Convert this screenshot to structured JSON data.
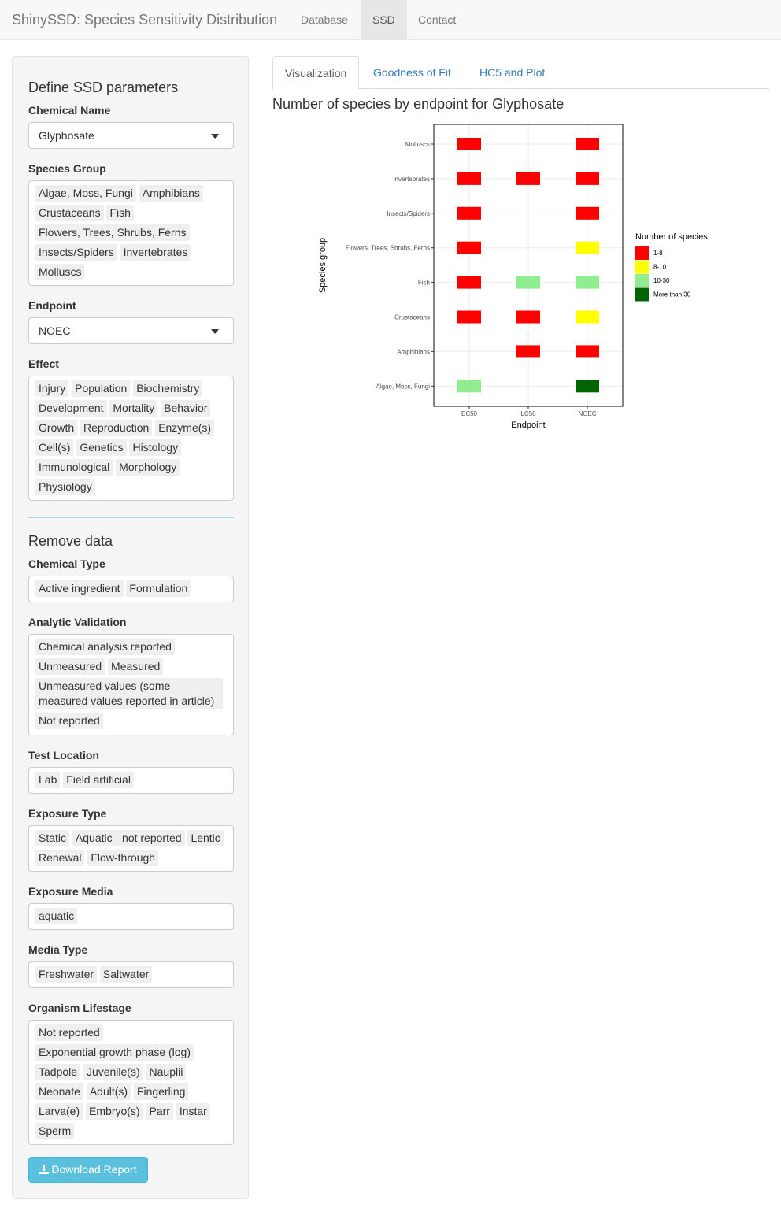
{
  "navbar": {
    "brand": "ShinySSD: Species Sensitivity Distribution",
    "items": [
      "Database",
      "SSD",
      "Contact"
    ],
    "active": "SSD"
  },
  "sidebar": {
    "define_title": "Define SSD parameters",
    "chemical_name": {
      "label": "Chemical Name",
      "value": "Glyphosate"
    },
    "species_group": {
      "label": "Species Group",
      "selected": [
        "Algae, Moss, Fungi",
        "Amphibians",
        "Crustaceans",
        "Fish",
        "Flowers, Trees, Shrubs, Ferns",
        "Insects/Spiders",
        "Invertebrates",
        "Molluscs"
      ]
    },
    "endpoint": {
      "label": "Endpoint",
      "value": "NOEC"
    },
    "effect": {
      "label": "Effect",
      "selected": [
        "Injury",
        "Population",
        "Biochemistry",
        "Development",
        "Mortality",
        "Behavior",
        "Growth",
        "Reproduction",
        "Enzyme(s)",
        "Cell(s)",
        "Genetics",
        "Histology",
        "Immunological",
        "Morphology",
        "Physiology"
      ]
    },
    "remove_title": "Remove data",
    "chemical_type": {
      "label": "Chemical Type",
      "selected": [
        "Active ingredient",
        "Formulation"
      ]
    },
    "analytic_validation": {
      "label": "Analytic Validation",
      "selected": [
        "Chemical analysis reported",
        "Unmeasured",
        "Measured",
        "Unmeasured values (some measured values reported in article)",
        "Not reported"
      ]
    },
    "test_location": {
      "label": "Test Location",
      "selected": [
        "Lab",
        "Field artificial"
      ]
    },
    "exposure_type": {
      "label": "Exposure Type",
      "selected": [
        "Static",
        "Aquatic - not reported",
        "Lentic",
        "Renewal",
        "Flow-through"
      ]
    },
    "exposure_media": {
      "label": "Exposure Media",
      "selected": [
        "aquatic"
      ]
    },
    "media_type": {
      "label": "Media Type",
      "selected": [
        "Freshwater",
        "Saltwater"
      ]
    },
    "organism_lifestage": {
      "label": "Organism Lifestage",
      "selected": [
        "Not reported",
        "Exponential growth phase (log)",
        "Tadpole",
        "Juvenile(s)",
        "Nauplii",
        "Neonate",
        "Adult(s)",
        "Fingerling",
        "Larva(e)",
        "Embryo(s)",
        "Parr",
        "Instar",
        "Sperm"
      ]
    },
    "download_label": "Download Report"
  },
  "main": {
    "tabs": [
      "Visualization",
      "Goodness of Fit",
      "HC5 and Plot"
    ],
    "active_tab": "Visualization",
    "plot_title": "Number of species by endpoint for Glyphosate"
  },
  "chart_data": {
    "type": "heatmap",
    "xlabel": "Endpoint",
    "ylabel": "Species group",
    "x": [
      "EC50",
      "LC50",
      "NOEC"
    ],
    "y": [
      "Algae, Moss, Fungi",
      "Amphibians",
      "Crustaceans",
      "Fish",
      "Flowers, Trees, Shrubs, Ferns",
      "Insects/Spiders",
      "Invertebrates",
      "Molluscs"
    ],
    "legend_title": "Number of species",
    "legend_placement": "right",
    "categories": [
      {
        "name": "1-8",
        "color": "#ff0000"
      },
      {
        "name": "8-10",
        "color": "#ffff00"
      },
      {
        "name": "10-30",
        "color": "#90ee90"
      },
      {
        "name": "More than 30",
        "color": "#006400"
      }
    ],
    "cells": [
      {
        "x": "EC50",
        "y": "Molluscs",
        "category": "1-8"
      },
      {
        "x": "NOEC",
        "y": "Molluscs",
        "category": "1-8"
      },
      {
        "x": "EC50",
        "y": "Invertebrates",
        "category": "1-8"
      },
      {
        "x": "LC50",
        "y": "Invertebrates",
        "category": "1-8"
      },
      {
        "x": "NOEC",
        "y": "Invertebrates",
        "category": "1-8"
      },
      {
        "x": "EC50",
        "y": "Insects/Spiders",
        "category": "1-8"
      },
      {
        "x": "NOEC",
        "y": "Insects/Spiders",
        "category": "1-8"
      },
      {
        "x": "EC50",
        "y": "Flowers, Trees, Shrubs, Ferns",
        "category": "1-8"
      },
      {
        "x": "NOEC",
        "y": "Flowers, Trees, Shrubs, Ferns",
        "category": "8-10"
      },
      {
        "x": "EC50",
        "y": "Fish",
        "category": "1-8"
      },
      {
        "x": "LC50",
        "y": "Fish",
        "category": "10-30"
      },
      {
        "x": "NOEC",
        "y": "Fish",
        "category": "10-30"
      },
      {
        "x": "EC50",
        "y": "Crustaceans",
        "category": "1-8"
      },
      {
        "x": "LC50",
        "y": "Crustaceans",
        "category": "1-8"
      },
      {
        "x": "NOEC",
        "y": "Crustaceans",
        "category": "8-10"
      },
      {
        "x": "LC50",
        "y": "Amphibians",
        "category": "1-8"
      },
      {
        "x": "NOEC",
        "y": "Amphibians",
        "category": "1-8"
      },
      {
        "x": "EC50",
        "y": "Algae, Moss, Fungi",
        "category": "10-30"
      },
      {
        "x": "NOEC",
        "y": "Algae, Moss, Fungi",
        "category": "More than 30"
      }
    ]
  }
}
